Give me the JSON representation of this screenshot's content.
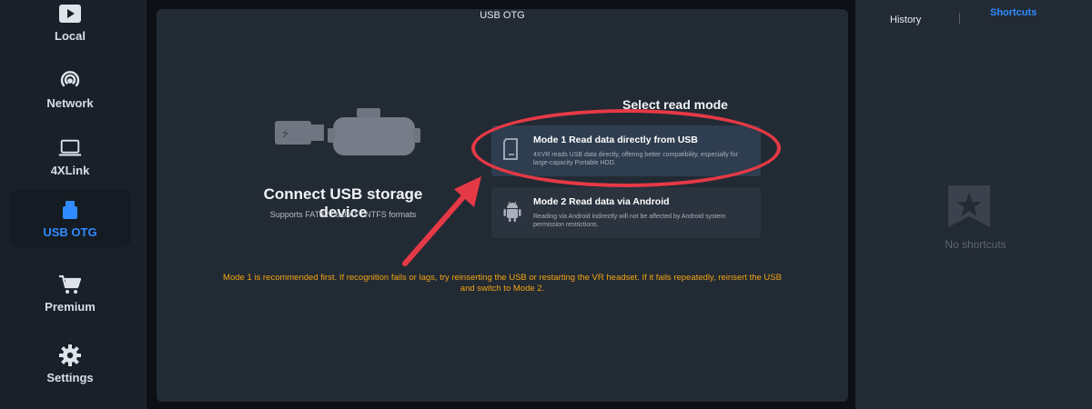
{
  "window": {
    "title": "USB OTG"
  },
  "sidebar": {
    "items": [
      {
        "label": "Local",
        "icon": "play-icon",
        "active": false
      },
      {
        "label": "Network",
        "icon": "wifi-icon",
        "active": false
      },
      {
        "label": "4XLink",
        "icon": "laptop-icon",
        "active": false
      },
      {
        "label": "USB OTG",
        "icon": "usb-drive-icon",
        "active": true
      },
      {
        "label": "Premium",
        "icon": "cart-icon",
        "active": false
      },
      {
        "label": "Settings",
        "icon": "gear-icon",
        "active": false
      }
    ]
  },
  "main": {
    "connect_title": "Connect USB storage device",
    "connect_subtitle": "Supports FAT32 / exFAT / NTFS formats",
    "mode_header": "Select read mode",
    "modes": [
      {
        "title": "Mode 1 Read data directly from USB",
        "description": "4XVR reads USB data directly, offering better compatibility, especially for large-capacity Portable HDD.",
        "icon": "sd-card-icon"
      },
      {
        "title": "Mode 2 Read data via Android",
        "description": "Reading via Android indirectly will not be affected by Android system permission restrictions.",
        "icon": "android-icon"
      }
    ],
    "warning": "Mode 1 is recommended first. If recognition fails or lags, try reinserting the USB or restarting the VR headset. If it fails repeatedly, reinsert the USB and switch to Mode 2."
  },
  "right_panel": {
    "tabs": [
      "History",
      "Shortcuts"
    ],
    "active_tab": "Shortcuts",
    "empty_text": "No shortcuts"
  },
  "colors": {
    "accent": "#2f8bff",
    "warning": "#f2a413",
    "highlight": "#e63946",
    "panel": "#222a34",
    "sidebar": "#1a2029"
  }
}
